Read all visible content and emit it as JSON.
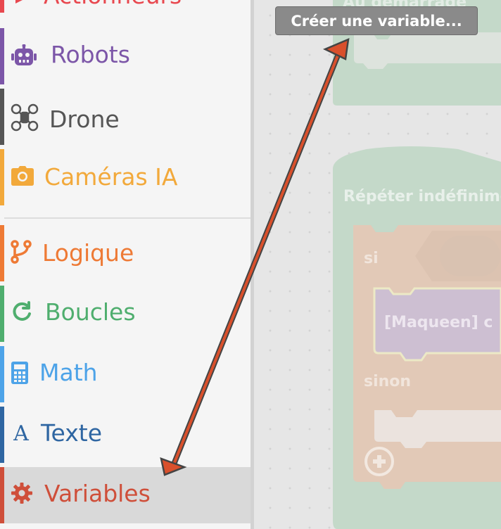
{
  "sidebar": {
    "categories": [
      {
        "label": "Actionneurs",
        "icon": "actuator-icon",
        "color": "#e8484f"
      },
      {
        "label": "Robots",
        "icon": "robot-icon",
        "color": "#7c56a8"
      },
      {
        "label": "Drone",
        "icon": "drone-icon",
        "color": "#555555"
      },
      {
        "label": "Caméras IA",
        "icon": "camera-icon",
        "color": "#f2a93b"
      },
      {
        "label": "Logique",
        "icon": "branch-icon",
        "color": "#ee7a35"
      },
      {
        "label": "Boucles",
        "icon": "loop-icon",
        "color": "#4fae6e"
      },
      {
        "label": "Math",
        "icon": "calculator-icon",
        "color": "#4da3e8"
      },
      {
        "label": "Texte",
        "icon": "text-icon",
        "color": "#2f66a2"
      },
      {
        "label": "Variables",
        "icon": "gear-icon",
        "color": "#cf4f3a",
        "selected": true
      }
    ]
  },
  "workspace": {
    "tooltip": "Créer une variable...",
    "blocks": {
      "start_label": "Au démarrage",
      "loop_label": "Répéter indéfiniment",
      "if_label": "si",
      "else_label": "sinon",
      "inner_block_label": "[Maqueen] c"
    }
  },
  "colors": {
    "annotation_arrow": "#d9502c",
    "arrow_outline": "#444444"
  }
}
